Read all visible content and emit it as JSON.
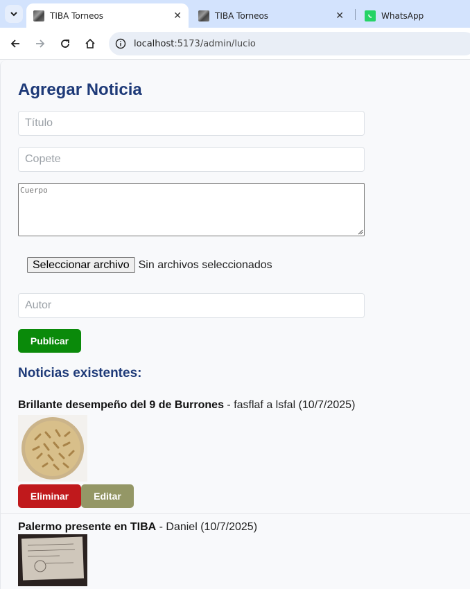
{
  "browser": {
    "tabs": [
      {
        "title": "TIBA Torneos",
        "close": "✕",
        "active": true,
        "icon": "tiba-favicon"
      },
      {
        "title": "TIBA Torneos",
        "close": "✕",
        "active": false,
        "icon": "tiba-favicon"
      },
      {
        "title": "WhatsApp",
        "active": false,
        "icon": "whatsapp-icon"
      }
    ],
    "url_host": "localhost",
    "url_path": ":5173/admin/lucio"
  },
  "form": {
    "heading": "Agregar Noticia",
    "title_placeholder": "Título",
    "copete_placeholder": "Copete",
    "cuerpo_placeholder": "Cuerpo",
    "file_button": "Seleccionar archivo",
    "file_status": "Sin archivos seleccionados",
    "autor_placeholder": "Autor",
    "publish_label": "Publicar"
  },
  "news": {
    "heading": "Noticias existentes:",
    "items": [
      {
        "title": "Brillante desempeño del 9 de Burrones",
        "meta": " - fasflaf a lsfal (10/7/2025)"
      },
      {
        "title": "Palermo presente en TIBA",
        "meta": " - Daniel (10/7/2025)"
      }
    ],
    "delete_label": "Eliminar",
    "edit_label": "Editar"
  },
  "colors": {
    "accent": "#1e3a78",
    "publish": "#0a8a0a",
    "delete": "#c0191c",
    "edit": "#949766"
  }
}
